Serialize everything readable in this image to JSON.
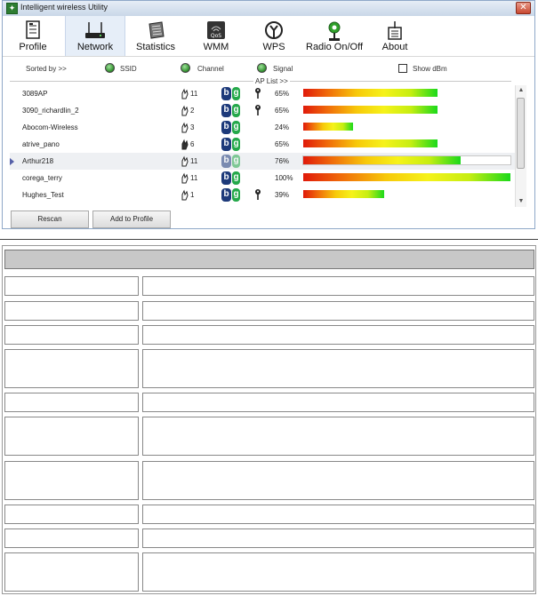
{
  "window": {
    "title": "Intelligent wireless Utility"
  },
  "toolbar": {
    "items": [
      {
        "label": "Profile",
        "icon": "profile-icon"
      },
      {
        "label": "Network",
        "icon": "network-icon",
        "active": true
      },
      {
        "label": "Statistics",
        "icon": "statistics-icon"
      },
      {
        "label": "WMM",
        "icon": "wmm-icon"
      },
      {
        "label": "WPS",
        "icon": "wps-icon"
      },
      {
        "label": "Radio On/Off",
        "icon": "radio-icon"
      },
      {
        "label": "About",
        "icon": "about-icon"
      }
    ]
  },
  "sort": {
    "label": "Sorted by >>",
    "ssid": "SSID",
    "channel": "Channel",
    "signal": "Signal",
    "show_dbm": "Show dBm",
    "ap_list": "AP List >>"
  },
  "ap_list": [
    {
      "ssid": "3089AP",
      "channel": "11",
      "encrypted": true,
      "signal": "65%",
      "signal_value": 0.65
    },
    {
      "ssid": "3090_richardlin_2",
      "channel": "2",
      "encrypted": true,
      "signal": "65%",
      "signal_value": 0.65
    },
    {
      "ssid": "Abocom-Wireless",
      "channel": "3",
      "encrypted": false,
      "signal": "24%",
      "signal_value": 0.24
    },
    {
      "ssid": "atrive_pano",
      "channel": "6",
      "encrypted": false,
      "signal": "65%",
      "signal_value": 0.65
    },
    {
      "ssid": "Arthur218",
      "channel": "11",
      "encrypted": false,
      "signal": "76%",
      "signal_value": 0.76,
      "selected": true
    },
    {
      "ssid": "corega_terry",
      "channel": "11",
      "encrypted": false,
      "signal": "100%",
      "signal_value": 1.0
    },
    {
      "ssid": "Hughes_Test",
      "channel": "1",
      "encrypted": true,
      "signal": "39%",
      "signal_value": 0.39
    }
  ],
  "buttons": {
    "rescan": "Rescan",
    "add_to_profile": "Add to Profile"
  },
  "colors": {
    "signal_low": "#e01a0a",
    "signal_mid": "#f6f21a",
    "signal_high": "#1bd91b",
    "active_tab": "#e6eef8"
  }
}
